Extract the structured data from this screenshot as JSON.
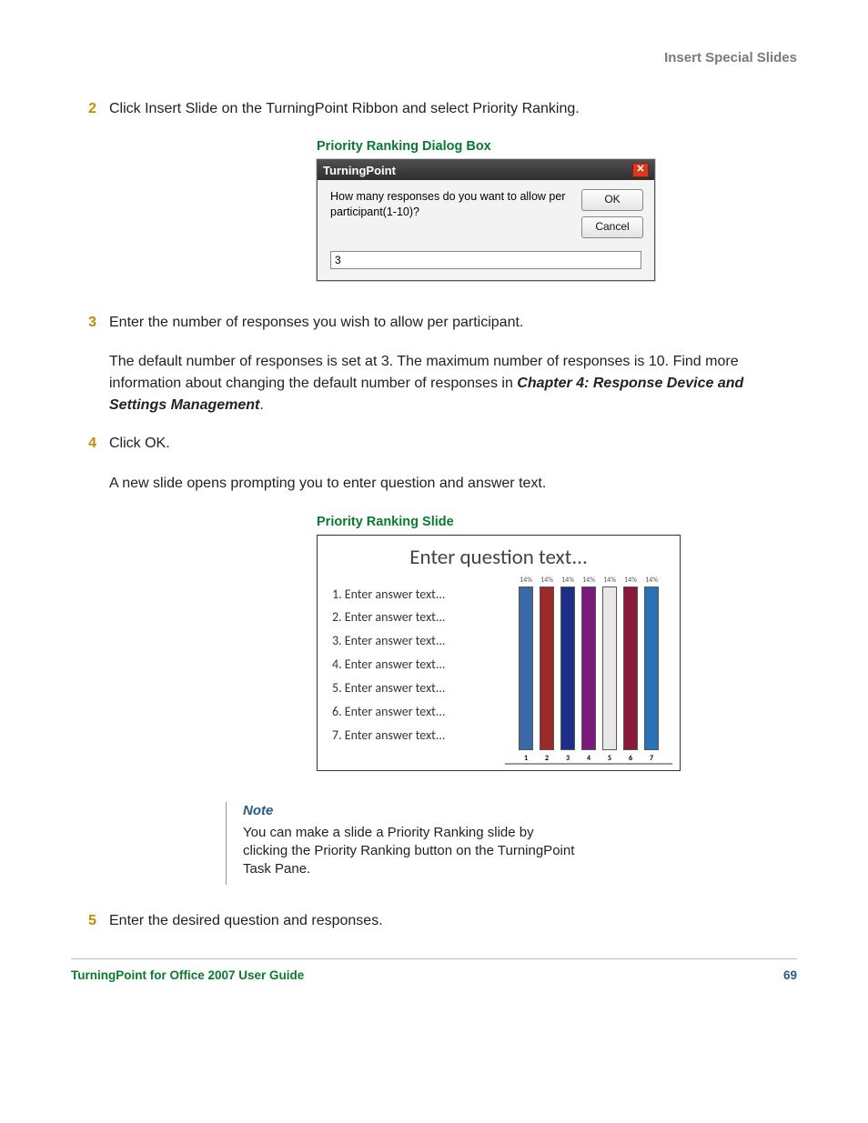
{
  "header": {
    "section": "Insert Special Slides"
  },
  "steps": {
    "s2": {
      "num": "2",
      "text": "Click Insert Slide on the TurningPoint Ribbon and select Priority Ranking."
    },
    "s3": {
      "num": "3",
      "text": "Enter the number of responses you wish to allow per participant."
    },
    "s3_detail_a": "The default number of responses is set at 3. The maximum number of responses is 10. Find more information about changing the default number of responses in ",
    "s3_detail_b": "Chapter 4: Response Device and Settings Management",
    "s3_detail_c": ".",
    "s4": {
      "num": "4",
      "text": "Click OK."
    },
    "s4_detail": "A new slide opens prompting you to enter question and answer text.",
    "s5": {
      "num": "5",
      "text": "Enter the desired question and responses."
    }
  },
  "fig1": {
    "caption": "Priority Ranking Dialog Box",
    "title": "TurningPoint",
    "question": "How many responses do you want to allow per participant(1-10)?",
    "ok": "OK",
    "cancel": "Cancel",
    "value": "3"
  },
  "fig2": {
    "caption": "Priority Ranking Slide",
    "title": "Enter question text...",
    "answers": [
      "1.  Enter answer text...",
      "2.  Enter answer text...",
      "3.  Enter answer text...",
      "4.  Enter answer text...",
      "5.  Enter answer text...",
      "6.  Enter answer text...",
      "7.  Enter answer text..."
    ]
  },
  "chart_data": {
    "type": "bar",
    "categories": [
      "1",
      "2",
      "3",
      "4",
      "5",
      "6",
      "7"
    ],
    "values": [
      14,
      14,
      14,
      14,
      14,
      14,
      14
    ],
    "value_labels": [
      "14%",
      "14%",
      "14%",
      "14%",
      "14%",
      "14%",
      "14%"
    ],
    "colors": [
      "#3a6aa8",
      "#9a2a2a",
      "#1a2e8a",
      "#7a1a7a",
      "#e8e8e8",
      "#8a1a3a",
      "#2a72b8"
    ],
    "ylim": [
      0,
      16
    ],
    "title": "",
    "xlabel": "",
    "ylabel": ""
  },
  "note": {
    "head": "Note",
    "text": "You can make a slide a Priority Ranking slide by clicking the Priority Ranking button on the TurningPoint Task Pane."
  },
  "footer": {
    "left": "TurningPoint for Office 2007 User Guide",
    "right": "69"
  }
}
